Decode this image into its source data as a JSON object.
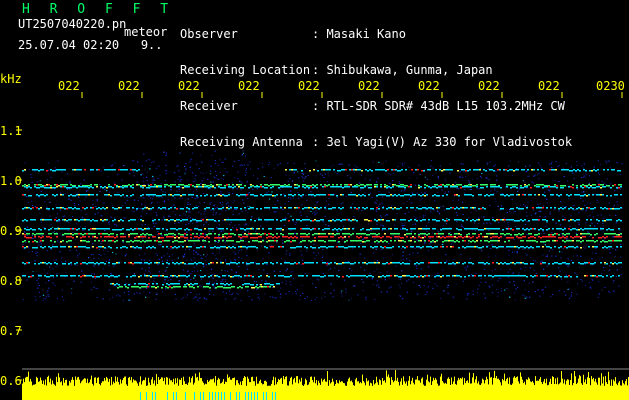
{
  "header": {
    "app_title": "H R O F F T",
    "filename": "UT2507040220.pn",
    "tag": "meteor",
    "datetime": "25.07.04 02:20   9..",
    "labels": [
      "Observer",
      "Receiving Location",
      "Receiver",
      "Receiving Antenna"
    ],
    "values": [
      ": Masaki Kano",
      ": Shibukawa, Gunma, Japan",
      ": RTL-SDR SDR# 43dB L15 103.2MHz CW",
      ": 3el Yagi(V) Az 330 for Vladivostok"
    ]
  },
  "axes": {
    "y_unit": "kHz",
    "y_ticks": [
      "1.1",
      "1.0",
      "0.9",
      "0.8",
      "0.7",
      "0.6"
    ],
    "x_ticks": [
      "022",
      "022",
      "022",
      "022",
      "022",
      "022",
      "022",
      "022",
      "022",
      "0230"
    ]
  },
  "colors": {
    "background": "#000000",
    "text_white": "#ffffff",
    "title_green": "#00ff66",
    "axis_yellow": "#ffff00",
    "noise_blue": "#1c2fd6",
    "line_cyan": "#00e0ff",
    "line_green": "#33ff66",
    "line_red": "#ff2020",
    "level_yellow": "#ffff00"
  }
}
